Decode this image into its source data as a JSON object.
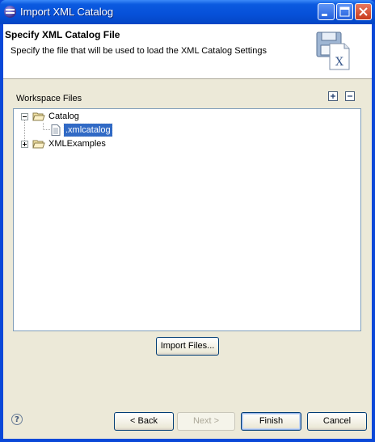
{
  "window": {
    "title": "Import XML Catalog",
    "controls": [
      "minimize-icon",
      "maximize-icon",
      "close-icon"
    ]
  },
  "header": {
    "title": "Specify XML Catalog File",
    "description": "Specify the file that will be used to load the XML Catalog Settings",
    "banner_icon": "xml-catalog-file-icon"
  },
  "workspace": {
    "label": "Workspace Files",
    "tree": [
      {
        "label": "Catalog",
        "expanded": true,
        "icon": "folder-open-icon",
        "children": [
          {
            "label": ".xmlcatalog",
            "icon": "file-icon",
            "selected": true
          }
        ]
      },
      {
        "label": "XMLExamples",
        "expanded": false,
        "icon": "folder-open-icon"
      }
    ]
  },
  "actions": {
    "import_files": "Import Files..."
  },
  "footer": {
    "back": "< Back",
    "next": "Next >",
    "finish": "Finish",
    "cancel": "Cancel"
  },
  "colors": {
    "selection": "#316ac5",
    "titlebar": "#0650d8",
    "dialog_bg": "#ece9d8"
  }
}
